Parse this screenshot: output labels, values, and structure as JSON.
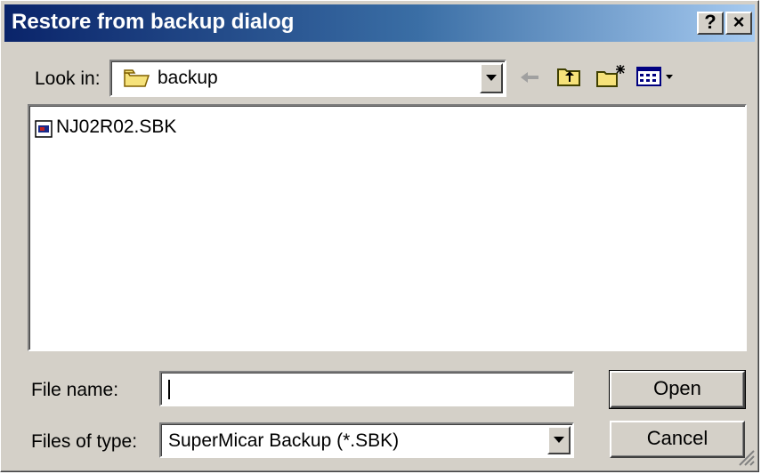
{
  "window": {
    "title": "Restore from backup dialog",
    "help_button": "?",
    "close_button": "×"
  },
  "look_in": {
    "label": "Look in:",
    "value": "backup"
  },
  "toolbar": {
    "icons": [
      "back-arrow-icon",
      "up-folder-icon",
      "new-folder-icon",
      "view-menu-icon"
    ]
  },
  "file_list": {
    "items": [
      {
        "name": "NJ02R02.SBK",
        "icon": "sbk-file-icon"
      }
    ]
  },
  "file_name": {
    "label": "File name:",
    "value": "",
    "placeholder": ""
  },
  "file_type": {
    "label": "Files of type:",
    "value": "SuperMicar Backup (*.SBK)"
  },
  "buttons": {
    "open": "Open",
    "cancel": "Cancel"
  },
  "colors": {
    "title_start": "#0a246a",
    "title_end": "#a6caf0",
    "face": "#d4d0c8"
  }
}
